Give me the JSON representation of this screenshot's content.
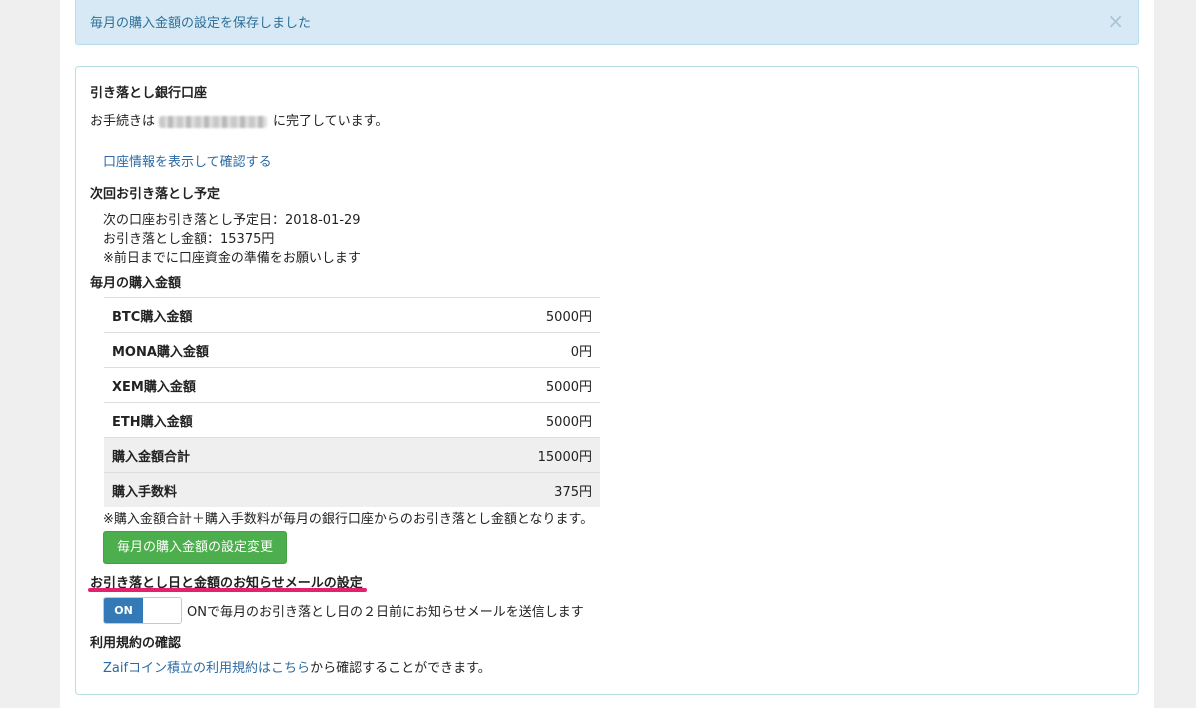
{
  "alert": {
    "message": "毎月の購入金額の設定を保存しました",
    "close_symbol": "×"
  },
  "bank": {
    "heading": "引き落とし銀行口座",
    "status_prefix": "お手続きは",
    "status_suffix": "に完了しています。",
    "show_info_link": "口座情報を表示して確認する"
  },
  "next_debit": {
    "heading": "次回お引き落とし予定",
    "date_line": "次の口座お引き落とし予定日：2018-01-29",
    "amount_line": "お引き落とし金額：15375円",
    "note": "※前日までに口座資金の準備をお願いします"
  },
  "monthly": {
    "heading": "毎月の購入金額",
    "rows": [
      {
        "label": "BTC購入金額",
        "value": "5000円"
      },
      {
        "label": "MONA購入金額",
        "value": "0円"
      },
      {
        "label": "XEM購入金額",
        "value": "5000円"
      },
      {
        "label": "ETH購入金額",
        "value": "5000円"
      },
      {
        "label": "購入金額合計",
        "value": "15000円"
      },
      {
        "label": "購入手数料",
        "value": "375円"
      }
    ],
    "note": "※購入金額合計＋購入手数料が毎月の銀行口座からのお引き落とし金額となります。",
    "change_button": "毎月の購入金額の設定変更"
  },
  "notify": {
    "heading": "お引き落とし日と金額のお知らせメールの設定",
    "toggle_label": "ON",
    "toggle_state": "on",
    "description": "ONで毎月のお引き落とし日の２日前にお知らせメールを送信します"
  },
  "terms": {
    "heading": "利用規約の確認",
    "link_text": "Zaifコイン積立の利用規約はこちら",
    "suffix": "から確認することができます。"
  },
  "colors": {
    "alert_bg": "#d6e9f4",
    "link": "#2d6aa3",
    "button_green": "#4cae4c",
    "toggle_blue": "#337ab7",
    "highlight_underline": "#e5216e"
  }
}
